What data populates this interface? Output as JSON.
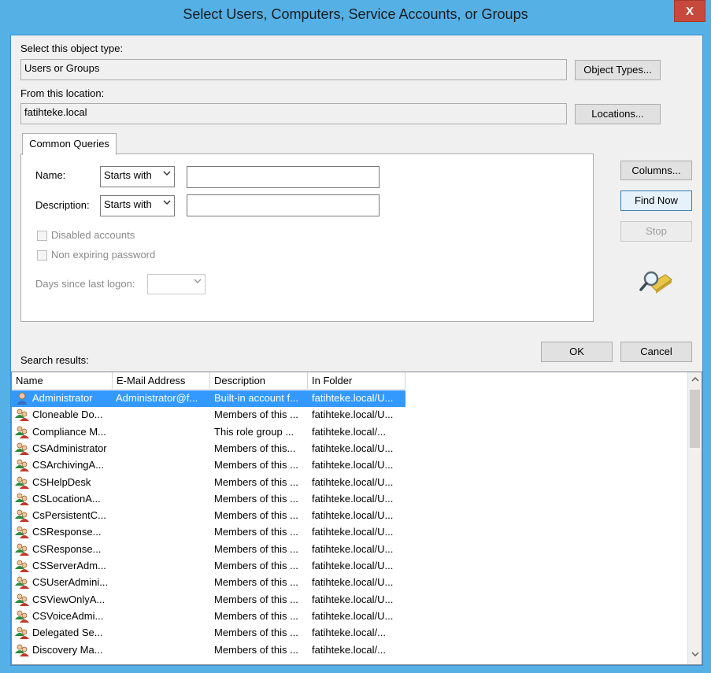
{
  "window": {
    "title": "Select Users, Computers, Service Accounts, or Groups",
    "close_glyph": "X"
  },
  "object_type": {
    "label": "Select this object type:",
    "value": "Users or Groups",
    "button": "Object Types..."
  },
  "location": {
    "label": "From this location:",
    "value": "fatihteke.local",
    "button": "Locations..."
  },
  "query": {
    "tab_label": "Common Queries",
    "name_label": "Name:",
    "name_mode": "Starts with",
    "name_value": "",
    "description_label": "Description:",
    "description_mode": "Starts with",
    "description_value": "",
    "disabled_accounts": "Disabled accounts",
    "non_expiring": "Non expiring password",
    "days_label": "Days since last logon:",
    "days_value": ""
  },
  "side_buttons": {
    "columns": "Columns...",
    "find_now": "Find Now",
    "stop": "Stop"
  },
  "dialog_buttons": {
    "ok": "OK",
    "cancel": "Cancel"
  },
  "results": {
    "label": "Search results:",
    "columns": [
      "Name",
      "E-Mail Address",
      "Description",
      "In Folder"
    ],
    "rows": [
      {
        "name": "Administrator",
        "email": "Administrator@f...",
        "description": "Built-in account f...",
        "folder": "fatihteke.local/U...",
        "icon": "user-icon",
        "selected": true
      },
      {
        "name": "Cloneable Do...",
        "email": "",
        "description": "Members of this ...",
        "folder": "fatihteke.local/U...",
        "icon": "group-icon"
      },
      {
        "name": "Compliance M...",
        "email": "",
        "description": "This role group ...",
        "folder": "fatihteke.local/...",
        "icon": "group-icon"
      },
      {
        "name": "CSAdministrator",
        "email": "",
        "description": "Members of this...",
        "folder": "fatihteke.local/U...",
        "icon": "group-icon"
      },
      {
        "name": "CSArchivingA...",
        "email": "",
        "description": "Members of this ...",
        "folder": "fatihteke.local/U...",
        "icon": "group-icon"
      },
      {
        "name": "CSHelpDesk",
        "email": "",
        "description": "Members of this ...",
        "folder": "fatihteke.local/U...",
        "icon": "group-icon"
      },
      {
        "name": "CSLocationA...",
        "email": "",
        "description": "Members of this ...",
        "folder": "fatihteke.local/U...",
        "icon": "group-icon"
      },
      {
        "name": "CsPersistentC...",
        "email": "",
        "description": "Members of this ...",
        "folder": "fatihteke.local/U...",
        "icon": "group-icon"
      },
      {
        "name": "CSResponse...",
        "email": "",
        "description": "Members of this ...",
        "folder": "fatihteke.local/U...",
        "icon": "group-icon"
      },
      {
        "name": "CSResponse...",
        "email": "",
        "description": "Members of this ...",
        "folder": "fatihteke.local/U...",
        "icon": "group-icon"
      },
      {
        "name": "CSServerAdm...",
        "email": "",
        "description": "Members of this ...",
        "folder": "fatihteke.local/U...",
        "icon": "group-icon"
      },
      {
        "name": "CSUserAdmini...",
        "email": "",
        "description": "Members of this ...",
        "folder": "fatihteke.local/U...",
        "icon": "group-icon"
      },
      {
        "name": "CSViewOnlyA...",
        "email": "",
        "description": "Members of this ...",
        "folder": "fatihteke.local/U...",
        "icon": "group-icon"
      },
      {
        "name": "CSVoiceAdmi...",
        "email": "",
        "description": "Members of this ...",
        "folder": "fatihteke.local/U...",
        "icon": "group-icon"
      },
      {
        "name": "Delegated Se...",
        "email": "",
        "description": "Members of this ...",
        "folder": "fatihteke.local/...",
        "icon": "group-icon"
      },
      {
        "name": "Discovery Ma...",
        "email": "",
        "description": "Members of this ...",
        "folder": "fatihteke.local/...",
        "icon": "group-icon"
      }
    ]
  },
  "colors": {
    "title_bar": "#55b0e6",
    "close_button": "#c7493b",
    "selection": "#3399ff"
  }
}
